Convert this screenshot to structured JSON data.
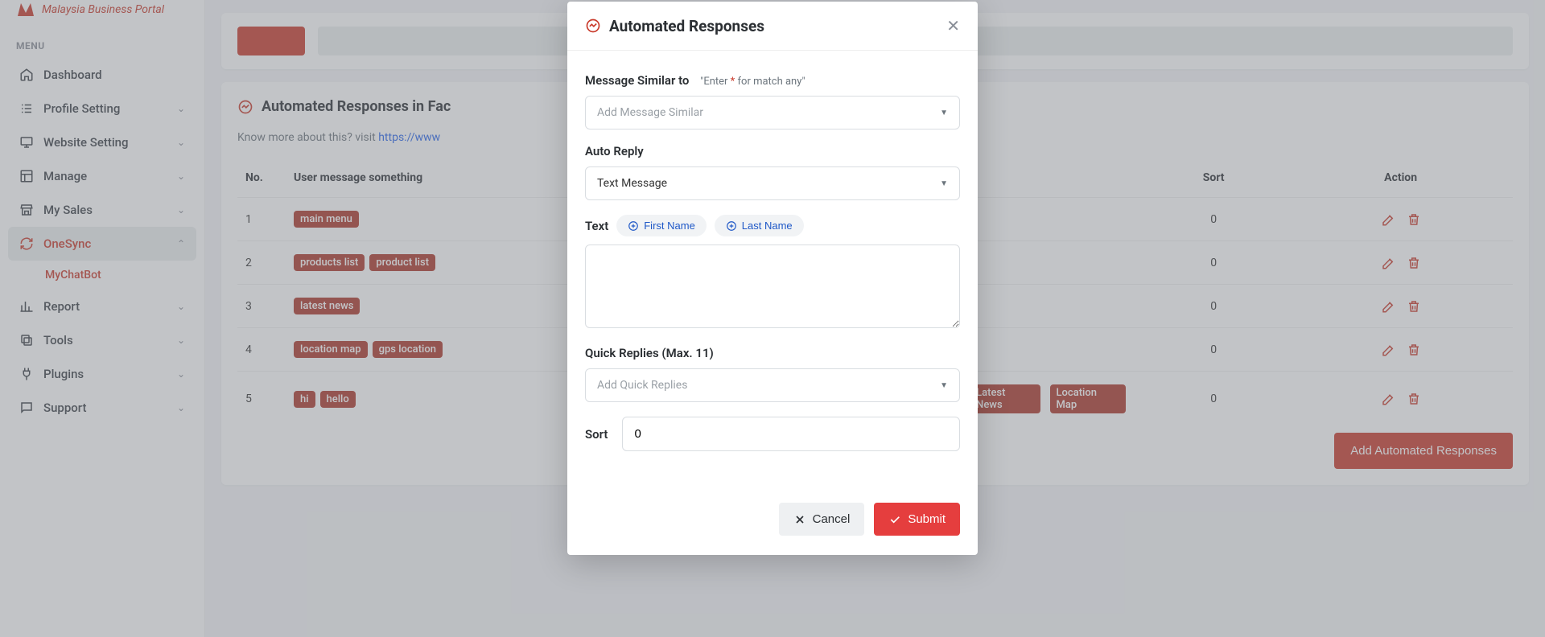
{
  "brand": {
    "tagline": "Malaysia Business Portal"
  },
  "sidebar": {
    "menuLabel": "MENU",
    "items": [
      {
        "label": "Dashboard",
        "icon": "home",
        "chev": false
      },
      {
        "label": "Profile Setting",
        "icon": "list",
        "chev": true
      },
      {
        "label": "Website Setting",
        "icon": "monitor",
        "chev": true
      },
      {
        "label": "Manage",
        "icon": "layout",
        "chev": true
      },
      {
        "label": "My Sales",
        "icon": "store",
        "chev": true
      },
      {
        "label": "OneSync",
        "icon": "refresh",
        "chev": true,
        "active": true,
        "open": true
      },
      {
        "label": "Report",
        "icon": "bar",
        "chev": true
      },
      {
        "label": "Tools",
        "icon": "copy",
        "chev": true
      },
      {
        "label": "Plugins",
        "icon": "plug",
        "chev": true
      },
      {
        "label": "Support",
        "icon": "chat",
        "chev": true
      }
    ],
    "subitem": "MyChatBot"
  },
  "page": {
    "cardTitle": "Automated Responses in Fac",
    "knowMorePrefix": "Know more about this? visit ",
    "knowMoreLink": "https://www",
    "columns": {
      "no": "No.",
      "msg": "User message something",
      "qr": "",
      "sort": "Sort",
      "action": "Action"
    },
    "rows": [
      {
        "no": "1",
        "tags": [
          "main menu"
        ],
        "qr": [],
        "sort": "0"
      },
      {
        "no": "2",
        "tags": [
          "products list",
          "product list"
        ],
        "qr": [],
        "sort": "0"
      },
      {
        "no": "3",
        "tags": [
          "latest news"
        ],
        "qr": [],
        "sort": "0"
      },
      {
        "no": "4",
        "tags": [
          "location map",
          "gps location"
        ],
        "qr": [],
        "sort": "0"
      },
      {
        "no": "5",
        "tags": [
          "hi",
          "hello"
        ],
        "qr": [
          "Latest News",
          "Location Map"
        ],
        "sort": "0"
      }
    ],
    "addBtn": "Add Automated Responses"
  },
  "modal": {
    "title": "Automated Responses",
    "msgSimilar": {
      "label": "Message Similar to",
      "hintPrefix": "\"Enter ",
      "hintStar": "*",
      "hintSuffix": " for match any\"",
      "placeholder": "Add Message Similar"
    },
    "autoReply": {
      "label": "Auto Reply",
      "value": "Text Message"
    },
    "text": {
      "label": "Text",
      "chipFirst": "First Name",
      "chipLast": "Last Name"
    },
    "quickReplies": {
      "label": "Quick Replies (Max. 11)",
      "placeholder": "Add Quick Replies"
    },
    "sort": {
      "label": "Sort",
      "value": "0"
    },
    "cancel": "Cancel",
    "submit": "Submit"
  }
}
